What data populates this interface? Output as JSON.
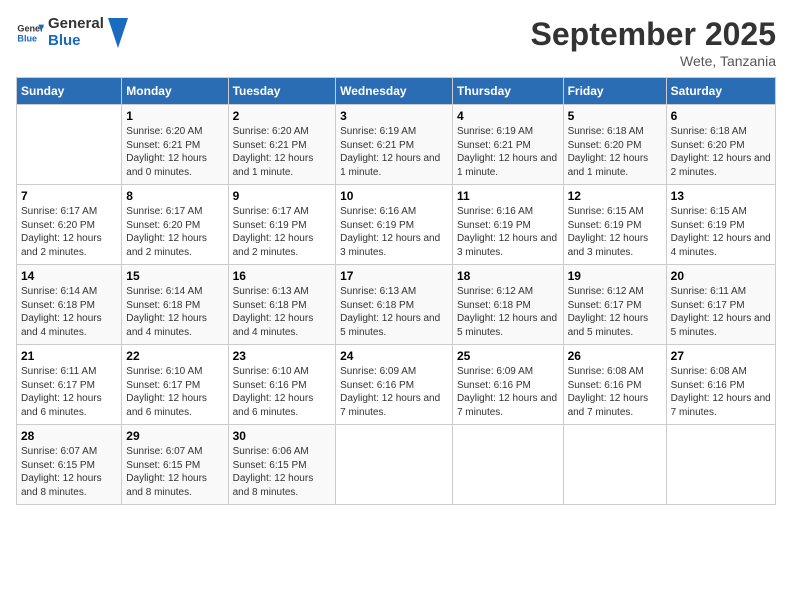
{
  "header": {
    "logo_general": "General",
    "logo_blue": "Blue",
    "month_title": "September 2025",
    "location": "Wete, Tanzania"
  },
  "days_of_week": [
    "Sunday",
    "Monday",
    "Tuesday",
    "Wednesday",
    "Thursday",
    "Friday",
    "Saturday"
  ],
  "weeks": [
    [
      null,
      {
        "day": 1,
        "sunrise": "6:20 AM",
        "sunset": "6:21 PM",
        "daylight": "12 hours and 0 minutes."
      },
      {
        "day": 2,
        "sunrise": "6:20 AM",
        "sunset": "6:21 PM",
        "daylight": "12 hours and 1 minute."
      },
      {
        "day": 3,
        "sunrise": "6:19 AM",
        "sunset": "6:21 PM",
        "daylight": "12 hours and 1 minute."
      },
      {
        "day": 4,
        "sunrise": "6:19 AM",
        "sunset": "6:21 PM",
        "daylight": "12 hours and 1 minute."
      },
      {
        "day": 5,
        "sunrise": "6:18 AM",
        "sunset": "6:20 PM",
        "daylight": "12 hours and 1 minute."
      },
      {
        "day": 6,
        "sunrise": "6:18 AM",
        "sunset": "6:20 PM",
        "daylight": "12 hours and 2 minutes."
      }
    ],
    [
      {
        "day": 7,
        "sunrise": "6:17 AM",
        "sunset": "6:20 PM",
        "daylight": "12 hours and 2 minutes."
      },
      {
        "day": 8,
        "sunrise": "6:17 AM",
        "sunset": "6:20 PM",
        "daylight": "12 hours and 2 minutes."
      },
      {
        "day": 9,
        "sunrise": "6:17 AM",
        "sunset": "6:19 PM",
        "daylight": "12 hours and 2 minutes."
      },
      {
        "day": 10,
        "sunrise": "6:16 AM",
        "sunset": "6:19 PM",
        "daylight": "12 hours and 3 minutes."
      },
      {
        "day": 11,
        "sunrise": "6:16 AM",
        "sunset": "6:19 PM",
        "daylight": "12 hours and 3 minutes."
      },
      {
        "day": 12,
        "sunrise": "6:15 AM",
        "sunset": "6:19 PM",
        "daylight": "12 hours and 3 minutes."
      },
      {
        "day": 13,
        "sunrise": "6:15 AM",
        "sunset": "6:19 PM",
        "daylight": "12 hours and 4 minutes."
      }
    ],
    [
      {
        "day": 14,
        "sunrise": "6:14 AM",
        "sunset": "6:18 PM",
        "daylight": "12 hours and 4 minutes."
      },
      {
        "day": 15,
        "sunrise": "6:14 AM",
        "sunset": "6:18 PM",
        "daylight": "12 hours and 4 minutes."
      },
      {
        "day": 16,
        "sunrise": "6:13 AM",
        "sunset": "6:18 PM",
        "daylight": "12 hours and 4 minutes."
      },
      {
        "day": 17,
        "sunrise": "6:13 AM",
        "sunset": "6:18 PM",
        "daylight": "12 hours and 5 minutes."
      },
      {
        "day": 18,
        "sunrise": "6:12 AM",
        "sunset": "6:18 PM",
        "daylight": "12 hours and 5 minutes."
      },
      {
        "day": 19,
        "sunrise": "6:12 AM",
        "sunset": "6:17 PM",
        "daylight": "12 hours and 5 minutes."
      },
      {
        "day": 20,
        "sunrise": "6:11 AM",
        "sunset": "6:17 PM",
        "daylight": "12 hours and 5 minutes."
      }
    ],
    [
      {
        "day": 21,
        "sunrise": "6:11 AM",
        "sunset": "6:17 PM",
        "daylight": "12 hours and 6 minutes."
      },
      {
        "day": 22,
        "sunrise": "6:10 AM",
        "sunset": "6:17 PM",
        "daylight": "12 hours and 6 minutes."
      },
      {
        "day": 23,
        "sunrise": "6:10 AM",
        "sunset": "6:16 PM",
        "daylight": "12 hours and 6 minutes."
      },
      {
        "day": 24,
        "sunrise": "6:09 AM",
        "sunset": "6:16 PM",
        "daylight": "12 hours and 7 minutes."
      },
      {
        "day": 25,
        "sunrise": "6:09 AM",
        "sunset": "6:16 PM",
        "daylight": "12 hours and 7 minutes."
      },
      {
        "day": 26,
        "sunrise": "6:08 AM",
        "sunset": "6:16 PM",
        "daylight": "12 hours and 7 minutes."
      },
      {
        "day": 27,
        "sunrise": "6:08 AM",
        "sunset": "6:16 PM",
        "daylight": "12 hours and 7 minutes."
      }
    ],
    [
      {
        "day": 28,
        "sunrise": "6:07 AM",
        "sunset": "6:15 PM",
        "daylight": "12 hours and 8 minutes."
      },
      {
        "day": 29,
        "sunrise": "6:07 AM",
        "sunset": "6:15 PM",
        "daylight": "12 hours and 8 minutes."
      },
      {
        "day": 30,
        "sunrise": "6:06 AM",
        "sunset": "6:15 PM",
        "daylight": "12 hours and 8 minutes."
      },
      null,
      null,
      null,
      null
    ]
  ]
}
